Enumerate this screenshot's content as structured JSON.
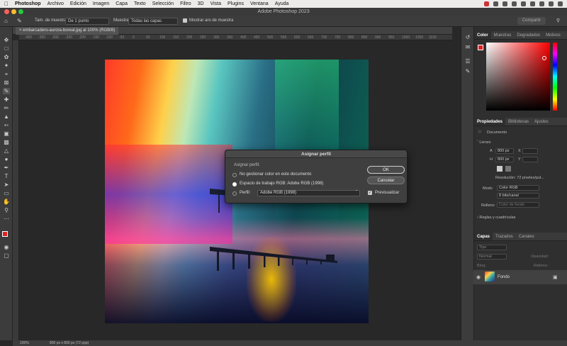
{
  "menubar": {
    "app": "Photoshop",
    "items": [
      "Archivo",
      "Edición",
      "Imagen",
      "Capa",
      "Texto",
      "Selección",
      "Filtro",
      "3D",
      "Vista",
      "Plugins",
      "Ventana",
      "Ayuda"
    ]
  },
  "window": {
    "title": "Adobe Photoshop 2023"
  },
  "options": {
    "sample_size_label": "Tam. de muestra:",
    "sample_size_value": "De 1 punto",
    "sample_label": "Muestra:",
    "sample_value": "Todas las capas",
    "ring_label": "Mostrar aro de muestra",
    "share": "Compartir"
  },
  "document": {
    "tab": "embarcadero-aurora-boreal.jpg al 100% (RGB/8)"
  },
  "ruler_ticks": [
    "-400",
    "-350",
    "-300",
    "-250",
    "-200",
    "-150",
    "-100",
    "-50",
    "0",
    "50",
    "100",
    "150",
    "200",
    "250",
    "300",
    "350",
    "400",
    "450",
    "500",
    "550",
    "600",
    "650",
    "700",
    "750",
    "800",
    "850",
    "900",
    "950",
    "1000",
    "1050",
    "1100"
  ],
  "status": {
    "zoom": "100%",
    "info": "800 px x 800 px (72 ppp)"
  },
  "dialog": {
    "title": "Asignar perfil",
    "section": "Asignar perfil:",
    "opt1": "No gestionar color en este documento",
    "opt2": "Espacio de trabajo RGB: Adobe RGB (1998)",
    "opt3": "Perfil:",
    "profile": "Adobe RGB (1998)",
    "ok": "OK",
    "cancel": "Cancelar",
    "preview": "Previsualizar"
  },
  "color_panel": {
    "tabs": [
      "Color",
      "Muestras",
      "Degradados",
      "Motivos"
    ]
  },
  "properties": {
    "tabs": [
      "Propiedades",
      "Bibliotecas",
      "Ajustes"
    ],
    "doc": "Documento",
    "canvas": "Lienzo",
    "w_label": "A",
    "w": "800 px",
    "h_label": "H",
    "h": "800 px",
    "x_label": "X",
    "y_label": "Y",
    "resolution": "Resolución: 72 píxeles/pul...",
    "mode_label": "Modo",
    "mode": "Color RGB",
    "bits": "8 bits/canal",
    "fill_label": "Relleno",
    "fill": "Color de fondo",
    "guides": "Reglas y cuadrículas"
  },
  "layers": {
    "tabs": [
      "Capas",
      "Trazados",
      "Canales"
    ],
    "kind": "Tipo",
    "blend": "Normal",
    "opacity_label": "Opacidad:",
    "lock_label": "Bloq:",
    "fill_label": "Relleno:",
    "layer_name": "Fondo"
  },
  "colors": {
    "accent": "#e02020",
    "dialog_bg": "#3f3f3f"
  }
}
